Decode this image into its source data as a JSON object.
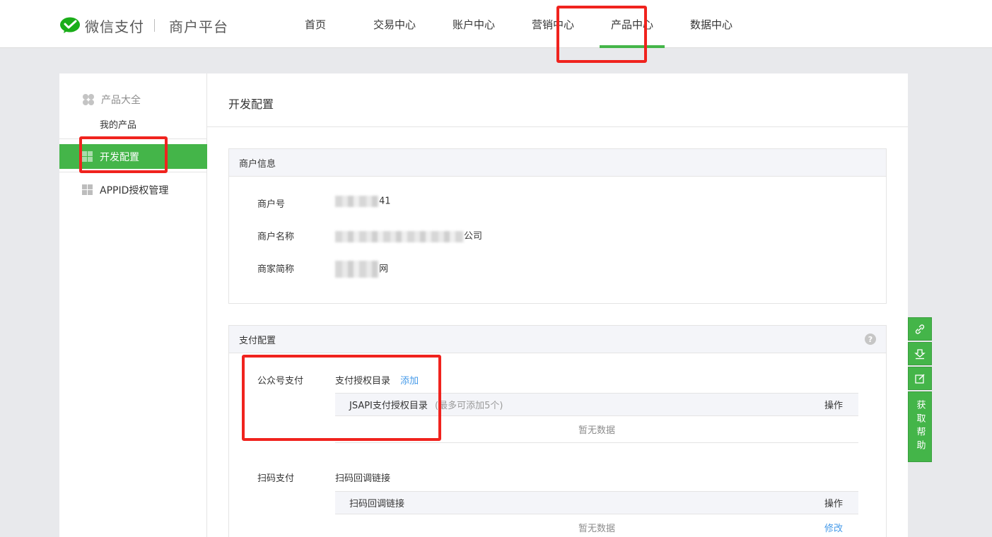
{
  "header": {
    "brand": "微信支付",
    "subtitle": "商户平台",
    "nav": [
      {
        "label": "首页"
      },
      {
        "label": "交易中心"
      },
      {
        "label": "账户中心"
      },
      {
        "label": "营销中心"
      },
      {
        "label": "产品中心",
        "active": true
      },
      {
        "label": "数据中心"
      }
    ]
  },
  "sidebar": {
    "group_title": "产品大全",
    "group_sub": "我的产品",
    "items": [
      {
        "label": "开发配置",
        "active": true
      },
      {
        "label": "APPID授权管理"
      }
    ]
  },
  "main": {
    "title": "开发配置",
    "merchant_panel": {
      "title": "商户信息",
      "rows": [
        {
          "label": "商户号",
          "value_suffix": "41"
        },
        {
          "label": "商户名称",
          "value_suffix": "公司"
        },
        {
          "label": "商家简称",
          "value_suffix": "网"
        }
      ]
    },
    "pay_panel": {
      "title": "支付配置",
      "help": "?",
      "sections": [
        {
          "label": "公众号支付",
          "sub_label": "支付授权目录",
          "sub_action": "添加",
          "table_header": "JSAPI支付授权目录",
          "table_header_note": "(最多可添加5个)",
          "table_action_header": "操作",
          "empty_text": "暂无数据",
          "row_action": ""
        },
        {
          "label": "扫码支付",
          "sub_label": "扫码回调链接",
          "sub_action": "",
          "table_header": "扫码回调链接",
          "table_header_note": "",
          "table_action_header": "操作",
          "empty_text": "暂无数据",
          "row_action": "修改"
        }
      ]
    }
  },
  "tools": {
    "help_label": "获取帮助"
  },
  "colors": {
    "accent": "#44b549",
    "annotation": "#f0231e",
    "link": "#459ae9"
  }
}
